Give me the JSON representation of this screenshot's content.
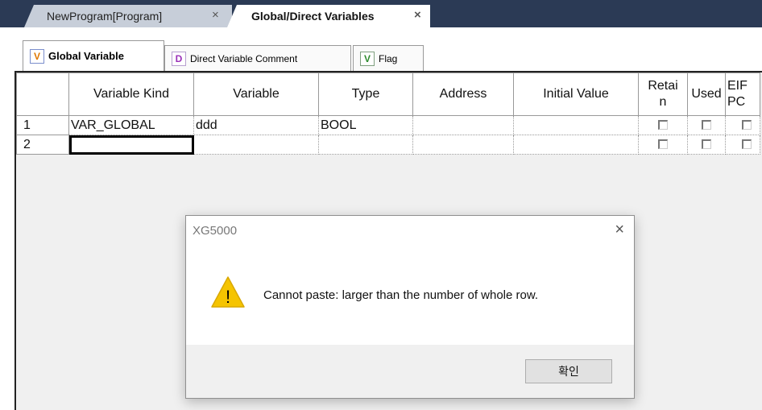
{
  "doc_tabs": [
    {
      "label": "NewProgram[Program]",
      "close": "×"
    },
    {
      "label": "Global/Direct Variables",
      "close": "×"
    }
  ],
  "sub_tabs": [
    {
      "icon": "V",
      "label": "Global Variable"
    },
    {
      "icon": "D",
      "label": "Direct Variable Comment"
    },
    {
      "icon": "V",
      "label": "Flag"
    }
  ],
  "grid": {
    "headers": [
      "Variable Kind",
      "Variable",
      "Type",
      "Address",
      "Initial Value",
      "Retain",
      "Used",
      "EIP/PC"
    ],
    "header_display": {
      "retain_line1": "Retai",
      "retain_line2": "n",
      "eip_line1": "EIF",
      "eip_line2": "PC"
    },
    "rows": [
      {
        "num": "1",
        "kind": "VAR_GLOBAL",
        "variable": "ddd",
        "type": "BOOL",
        "address": "",
        "initial": "",
        "retain": false,
        "used": false,
        "eip": false
      },
      {
        "num": "2",
        "kind": "",
        "variable": "",
        "type": "",
        "address": "",
        "initial": "",
        "retain": false,
        "used": false,
        "eip": false
      }
    ]
  },
  "dialog": {
    "title": "XG5000",
    "close": "×",
    "message": "Cannot paste: larger than the number of whole row.",
    "ok_label": "확인",
    "warn_glyph": "!"
  },
  "colors": {
    "titlebar": "#2b3a55",
    "warning": "#f5c400"
  }
}
